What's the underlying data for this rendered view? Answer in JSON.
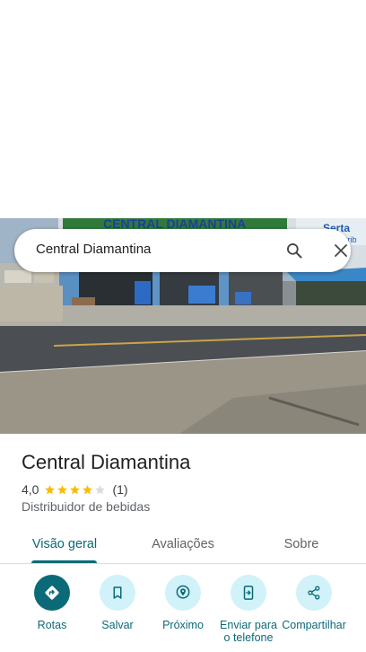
{
  "search": {
    "query": "Central Diamantina",
    "search_icon": "search-icon",
    "close_icon": "close-icon"
  },
  "photo": {
    "storefront_sign": "CENTRAL DIAMANTINA",
    "side_sign": "Serta",
    "side_sign_sub": "Distrib"
  },
  "place": {
    "title": "Central Diamantina",
    "rating": "4,0",
    "stars_filled": 4,
    "stars_total": 5,
    "review_count": "(1)",
    "category": "Distribuidor de bebidas"
  },
  "tabs": [
    {
      "label": "Visão geral",
      "active": true
    },
    {
      "label": "Avaliações",
      "active": false
    },
    {
      "label": "Sobre",
      "active": false
    }
  ],
  "actions": [
    {
      "label": "Rotas",
      "icon": "directions-icon"
    },
    {
      "label": "Salvar",
      "icon": "bookmark-icon"
    },
    {
      "label": "Próximo",
      "icon": "nearby-icon"
    },
    {
      "label": "Enviar para o telefone",
      "icon": "send-to-phone-icon"
    },
    {
      "label": "Compartilhar",
      "icon": "share-icon"
    }
  ],
  "colors": {
    "accent": "#0b6a78",
    "action_bg": "#d1f2f8",
    "star": "#fbbc04",
    "star_empty": "#dadce0"
  }
}
